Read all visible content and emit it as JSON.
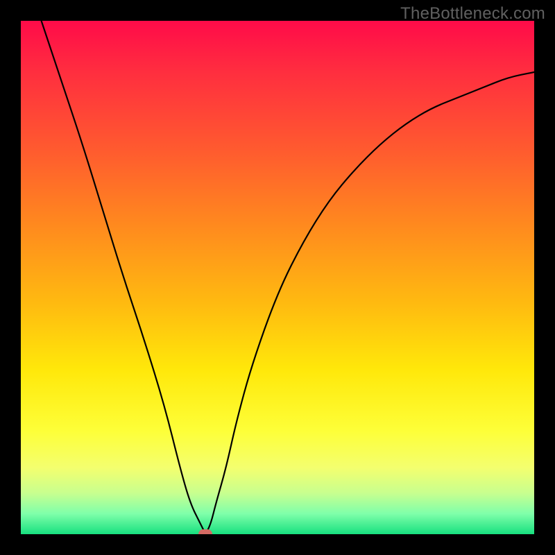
{
  "watermark": "TheBottleneck.com",
  "chart_data": {
    "type": "line",
    "title": "",
    "xlabel": "",
    "ylabel": "",
    "xlim": [
      0,
      100
    ],
    "ylim": [
      0,
      100
    ],
    "series": [
      {
        "name": "curve",
        "x": [
          4,
          8,
          12,
          16,
          20,
          24,
          28,
          31,
          33,
          35,
          36,
          37,
          38,
          40,
          42,
          45,
          50,
          55,
          60,
          65,
          70,
          75,
          80,
          85,
          90,
          95,
          100
        ],
        "y": [
          100,
          88,
          76,
          63,
          50,
          38,
          25,
          13,
          6,
          2,
          0,
          2,
          6,
          13,
          22,
          33,
          47,
          57,
          65,
          71,
          76,
          80,
          83,
          85,
          87,
          89,
          90
        ]
      }
    ],
    "marker": {
      "x": 36,
      "y": 0
    },
    "gradient_stops": [
      {
        "pct": 0,
        "color": "#ff0b49"
      },
      {
        "pct": 25,
        "color": "#ff5a2f"
      },
      {
        "pct": 55,
        "color": "#ffba10"
      },
      {
        "pct": 80,
        "color": "#fdff39"
      },
      {
        "pct": 100,
        "color": "#17e07f"
      }
    ]
  }
}
